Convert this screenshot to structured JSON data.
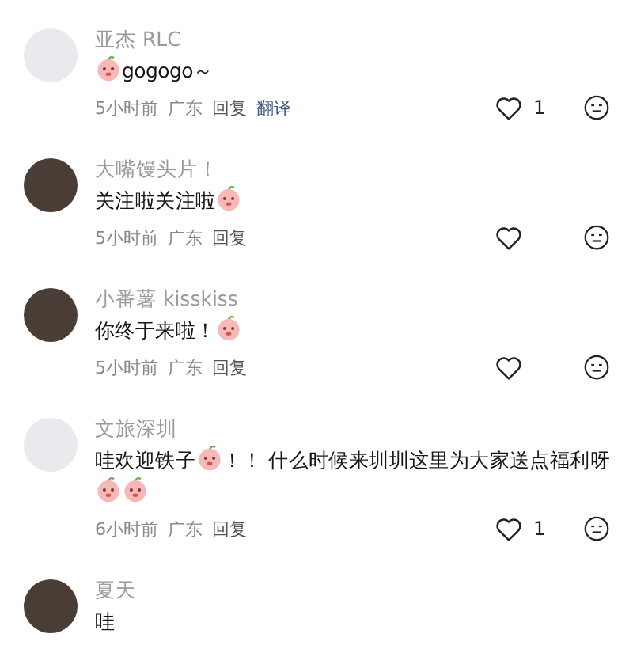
{
  "comments": [
    {
      "name": "亚杰 RLC",
      "kind": "logo",
      "content": [
        {
          "kind": "emoji"
        },
        {
          "kind": "text",
          "text": "gogogo～"
        }
      ],
      "time": "5小时前",
      "region": "广东",
      "reply": "回复",
      "translate": "翻译",
      "likes": "1"
    },
    {
      "name": "大嘴馒头片！",
      "kind": "photo",
      "content": [
        {
          "kind": "text",
          "text": "关注啦关注啦"
        },
        {
          "kind": "emoji"
        }
      ],
      "time": "5小时前",
      "region": "广东",
      "reply": "回复"
    },
    {
      "name": "小番薯 kisskiss",
      "kind": "photo",
      "content": [
        {
          "kind": "text",
          "text": "你终于来啦！"
        },
        {
          "kind": "emoji"
        }
      ],
      "time": "5小时前",
      "region": "广东",
      "reply": "回复"
    },
    {
      "name": "文旅深圳",
      "kind": "logo",
      "content": [
        {
          "kind": "text",
          "text": "哇欢迎铁子"
        },
        {
          "kind": "emoji"
        },
        {
          "kind": "text",
          "text": "！！ 什么时候来圳圳这里为大家送点福利呀"
        },
        {
          "kind": "emoji"
        },
        {
          "kind": "emoji"
        }
      ],
      "time": "6小时前",
      "region": "广东",
      "reply": "回复",
      "likes": "1"
    },
    {
      "name": "夏天",
      "kind": "photo",
      "content": [
        {
          "kind": "text",
          "text": "哇"
        }
      ]
    }
  ]
}
